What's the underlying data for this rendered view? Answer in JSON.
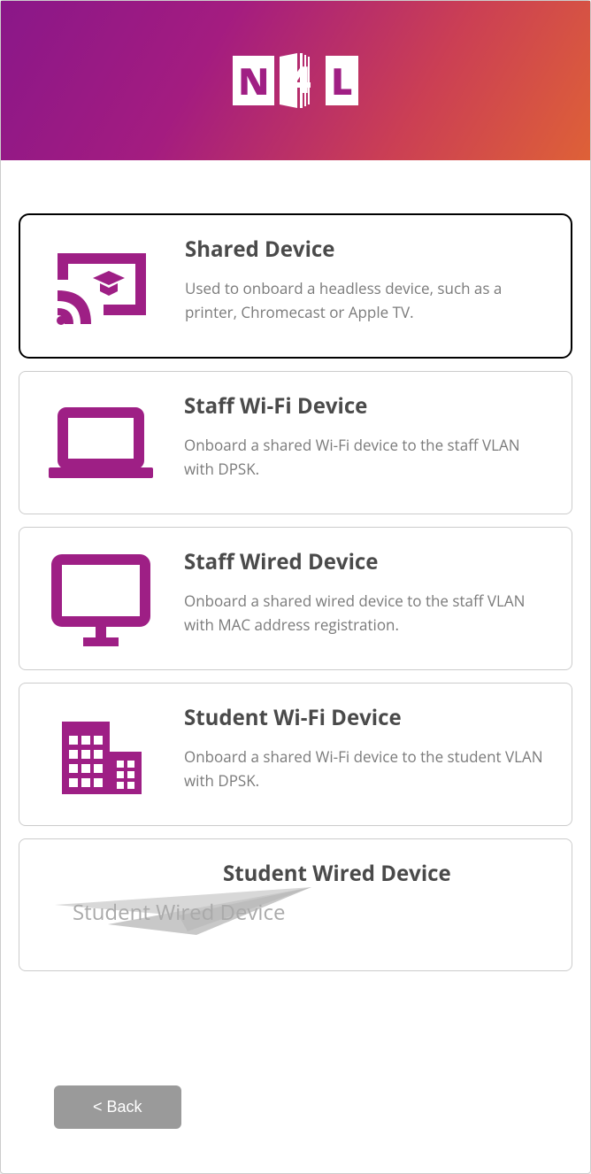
{
  "logo": {
    "n": "N",
    "four": "4",
    "l": "L"
  },
  "options": [
    {
      "id": "shared-device",
      "title": "Shared Device",
      "desc": "Used to onboard a headless device, such as a printer, Chromecast or Apple TV.",
      "selected": true
    },
    {
      "id": "staff-wifi-device",
      "title": "Staff Wi-Fi Device",
      "desc": "Onboard a shared Wi-Fi device to the staff VLAN with DPSK.",
      "selected": false
    },
    {
      "id": "staff-wired-device",
      "title": "Staff Wired Device",
      "desc": "Onboard a shared wired device to the staff VLAN with MAC address registration.",
      "selected": false
    },
    {
      "id": "student-wifi-device",
      "title": "Student Wi-Fi Device",
      "desc": "Onboard a shared Wi-Fi device to the student VLAN with DPSK.",
      "selected": false
    },
    {
      "id": "student-wired-device",
      "title": "Student Wired Device",
      "desc": "",
      "selected": false,
      "watermark": "Student Wired Device"
    }
  ],
  "buttons": {
    "back": "< Back"
  },
  "colors": {
    "brand": "#9e1f85"
  }
}
